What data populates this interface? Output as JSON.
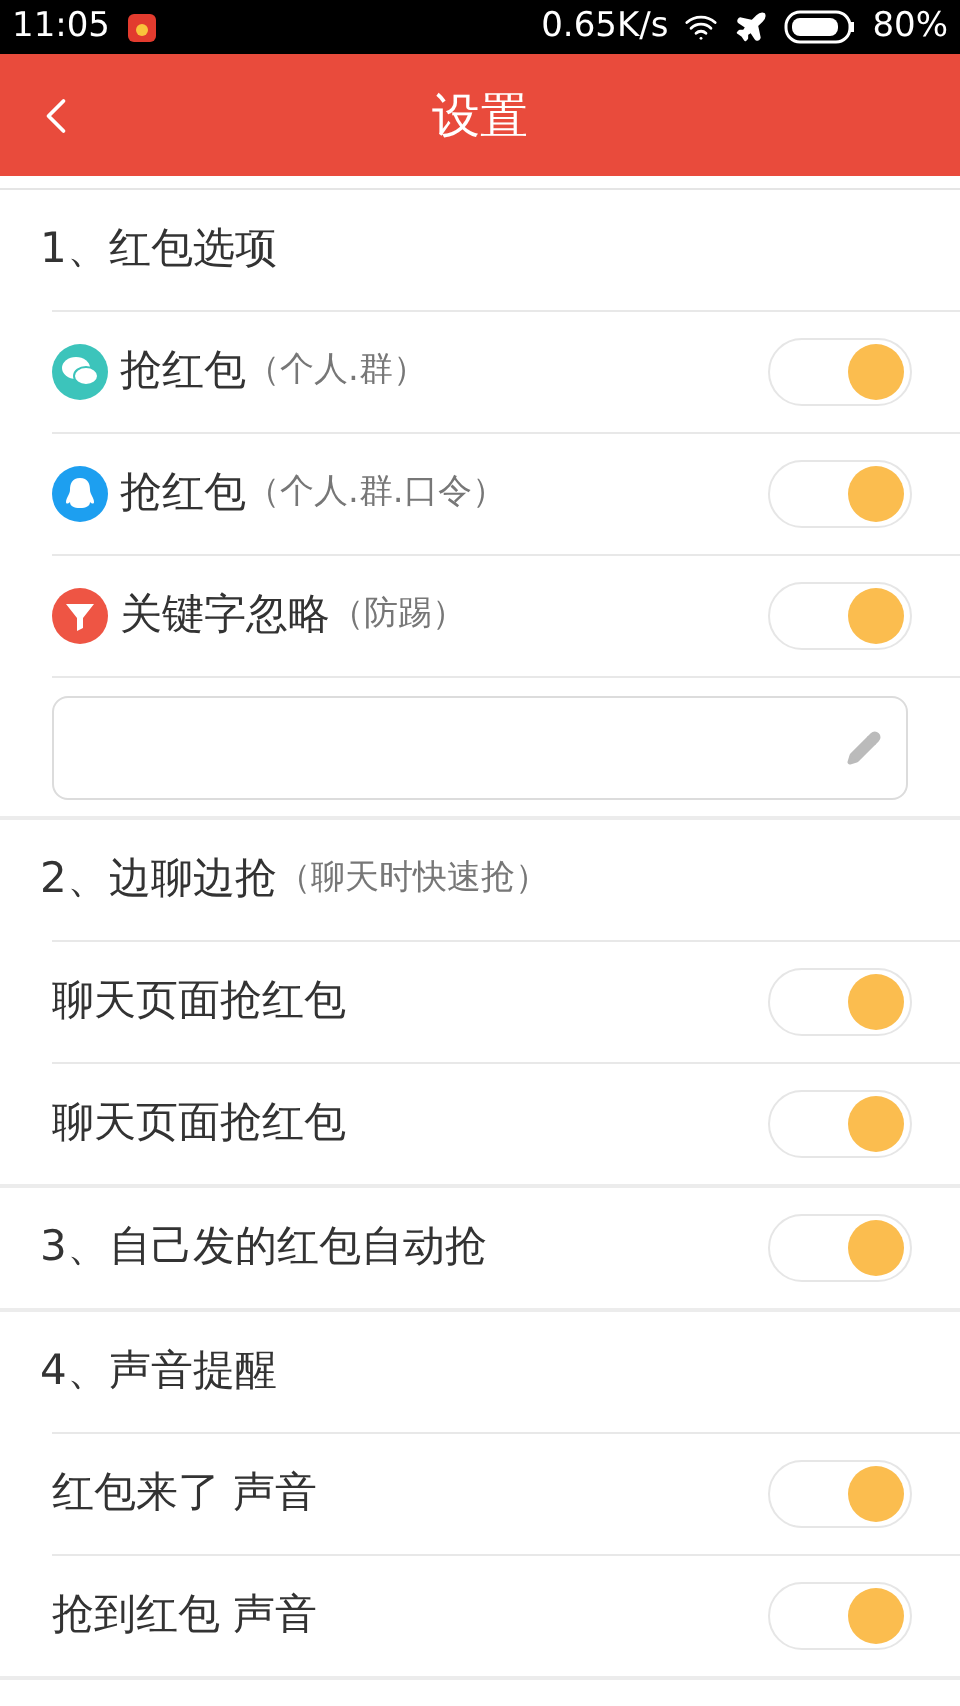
{
  "status_bar": {
    "time": "11:05",
    "speed": "0.65K/s",
    "battery": "80%"
  },
  "header": {
    "title": "设置"
  },
  "sections": [
    {
      "title": "1、红包选项",
      "items": [
        {
          "kind": "toggle",
          "label": "抢红包",
          "note": "（个人.群）",
          "on": true
        },
        {
          "kind": "toggle",
          "label": "抢红包",
          "note": "（个人.群.口令）",
          "on": true
        },
        {
          "kind": "toggle",
          "label": "关键字忽略",
          "note": "（防踢）",
          "on": true
        },
        {
          "kind": "field"
        }
      ]
    },
    {
      "title": "2、边聊边抢",
      "note": "（聊天时快速抢）",
      "items": [
        {
          "kind": "toggle",
          "label": "聊天页面抢红包",
          "on": true
        },
        {
          "kind": "toggle",
          "label": "聊天页面抢红包",
          "on": true
        }
      ]
    },
    {
      "title": "3、自己发的红包自动抢",
      "toggle": {
        "on": true
      }
    },
    {
      "title": "4、声音提醒",
      "items": [
        {
          "kind": "toggle",
          "label": "红包来了 声音",
          "on": true
        },
        {
          "kind": "toggle",
          "label": "抢到红包 声音",
          "on": true
        }
      ]
    }
  ]
}
